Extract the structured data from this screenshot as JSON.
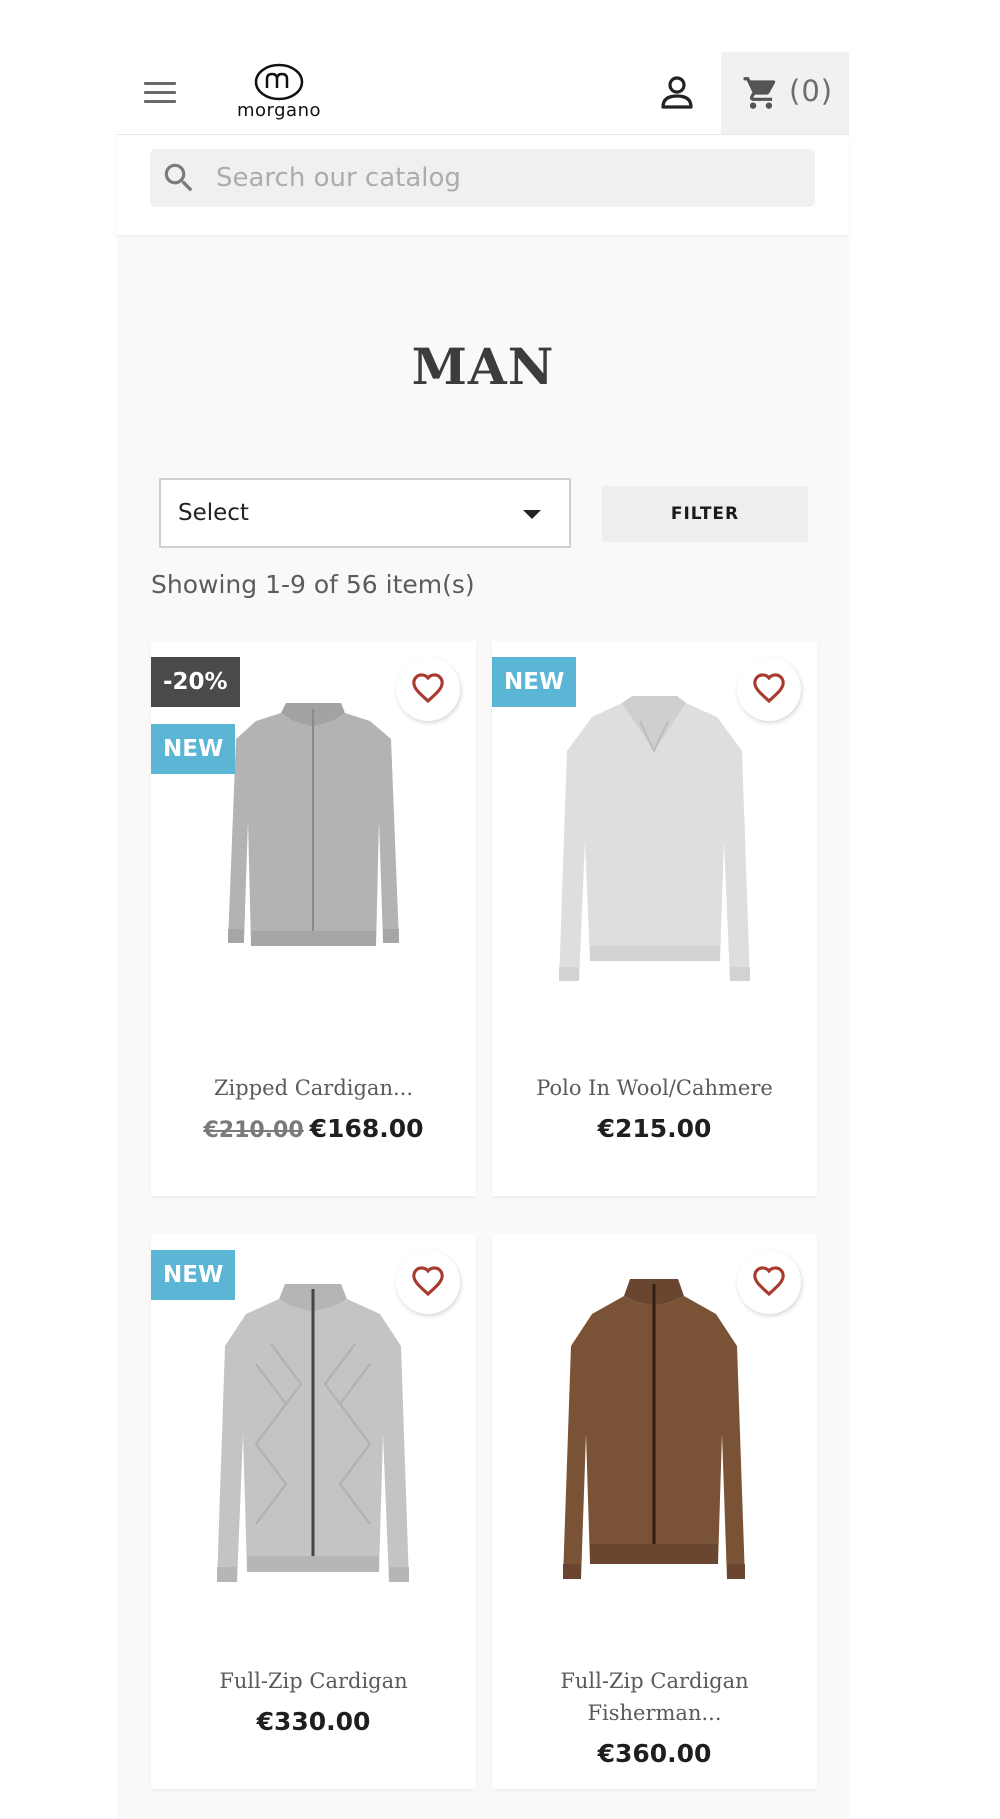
{
  "header": {
    "logo_text": "morgano",
    "cart_count": "(0)"
  },
  "search": {
    "placeholder": "Search our catalog"
  },
  "main": {
    "title": "MAN",
    "sort": {
      "selected": "Select"
    },
    "filter_label": "FILTER",
    "showing": "Showing 1-9 of 56 item(s)"
  },
  "colors": {
    "badge_new": "#5bb5d4",
    "badge_discount": "#4a4a4a",
    "heart": "#a83a2e",
    "page_background": "#faf9f7"
  },
  "products": [
    {
      "name": "Zipped Cardigan...",
      "old_price": "€210.00",
      "price": "€168.00",
      "badges": [
        "-20%",
        "NEW"
      ],
      "icon": "grey-zipped-cardigan"
    },
    {
      "name": "Polo In Wool/Cahmere",
      "price": "€215.00",
      "badges": [
        "NEW"
      ],
      "icon": "light-grey-polo-sweater"
    },
    {
      "name": "Full-Zip Cardigan",
      "price": "€330.00",
      "badges": [
        "NEW"
      ],
      "icon": "grey-cable-knit-cardigan"
    },
    {
      "name_line1": "Full-Zip Cardigan",
      "name_line2": "Fisherman...",
      "price": "€360.00",
      "badges": [],
      "icon": "brown-fisherman-cardigan"
    }
  ]
}
